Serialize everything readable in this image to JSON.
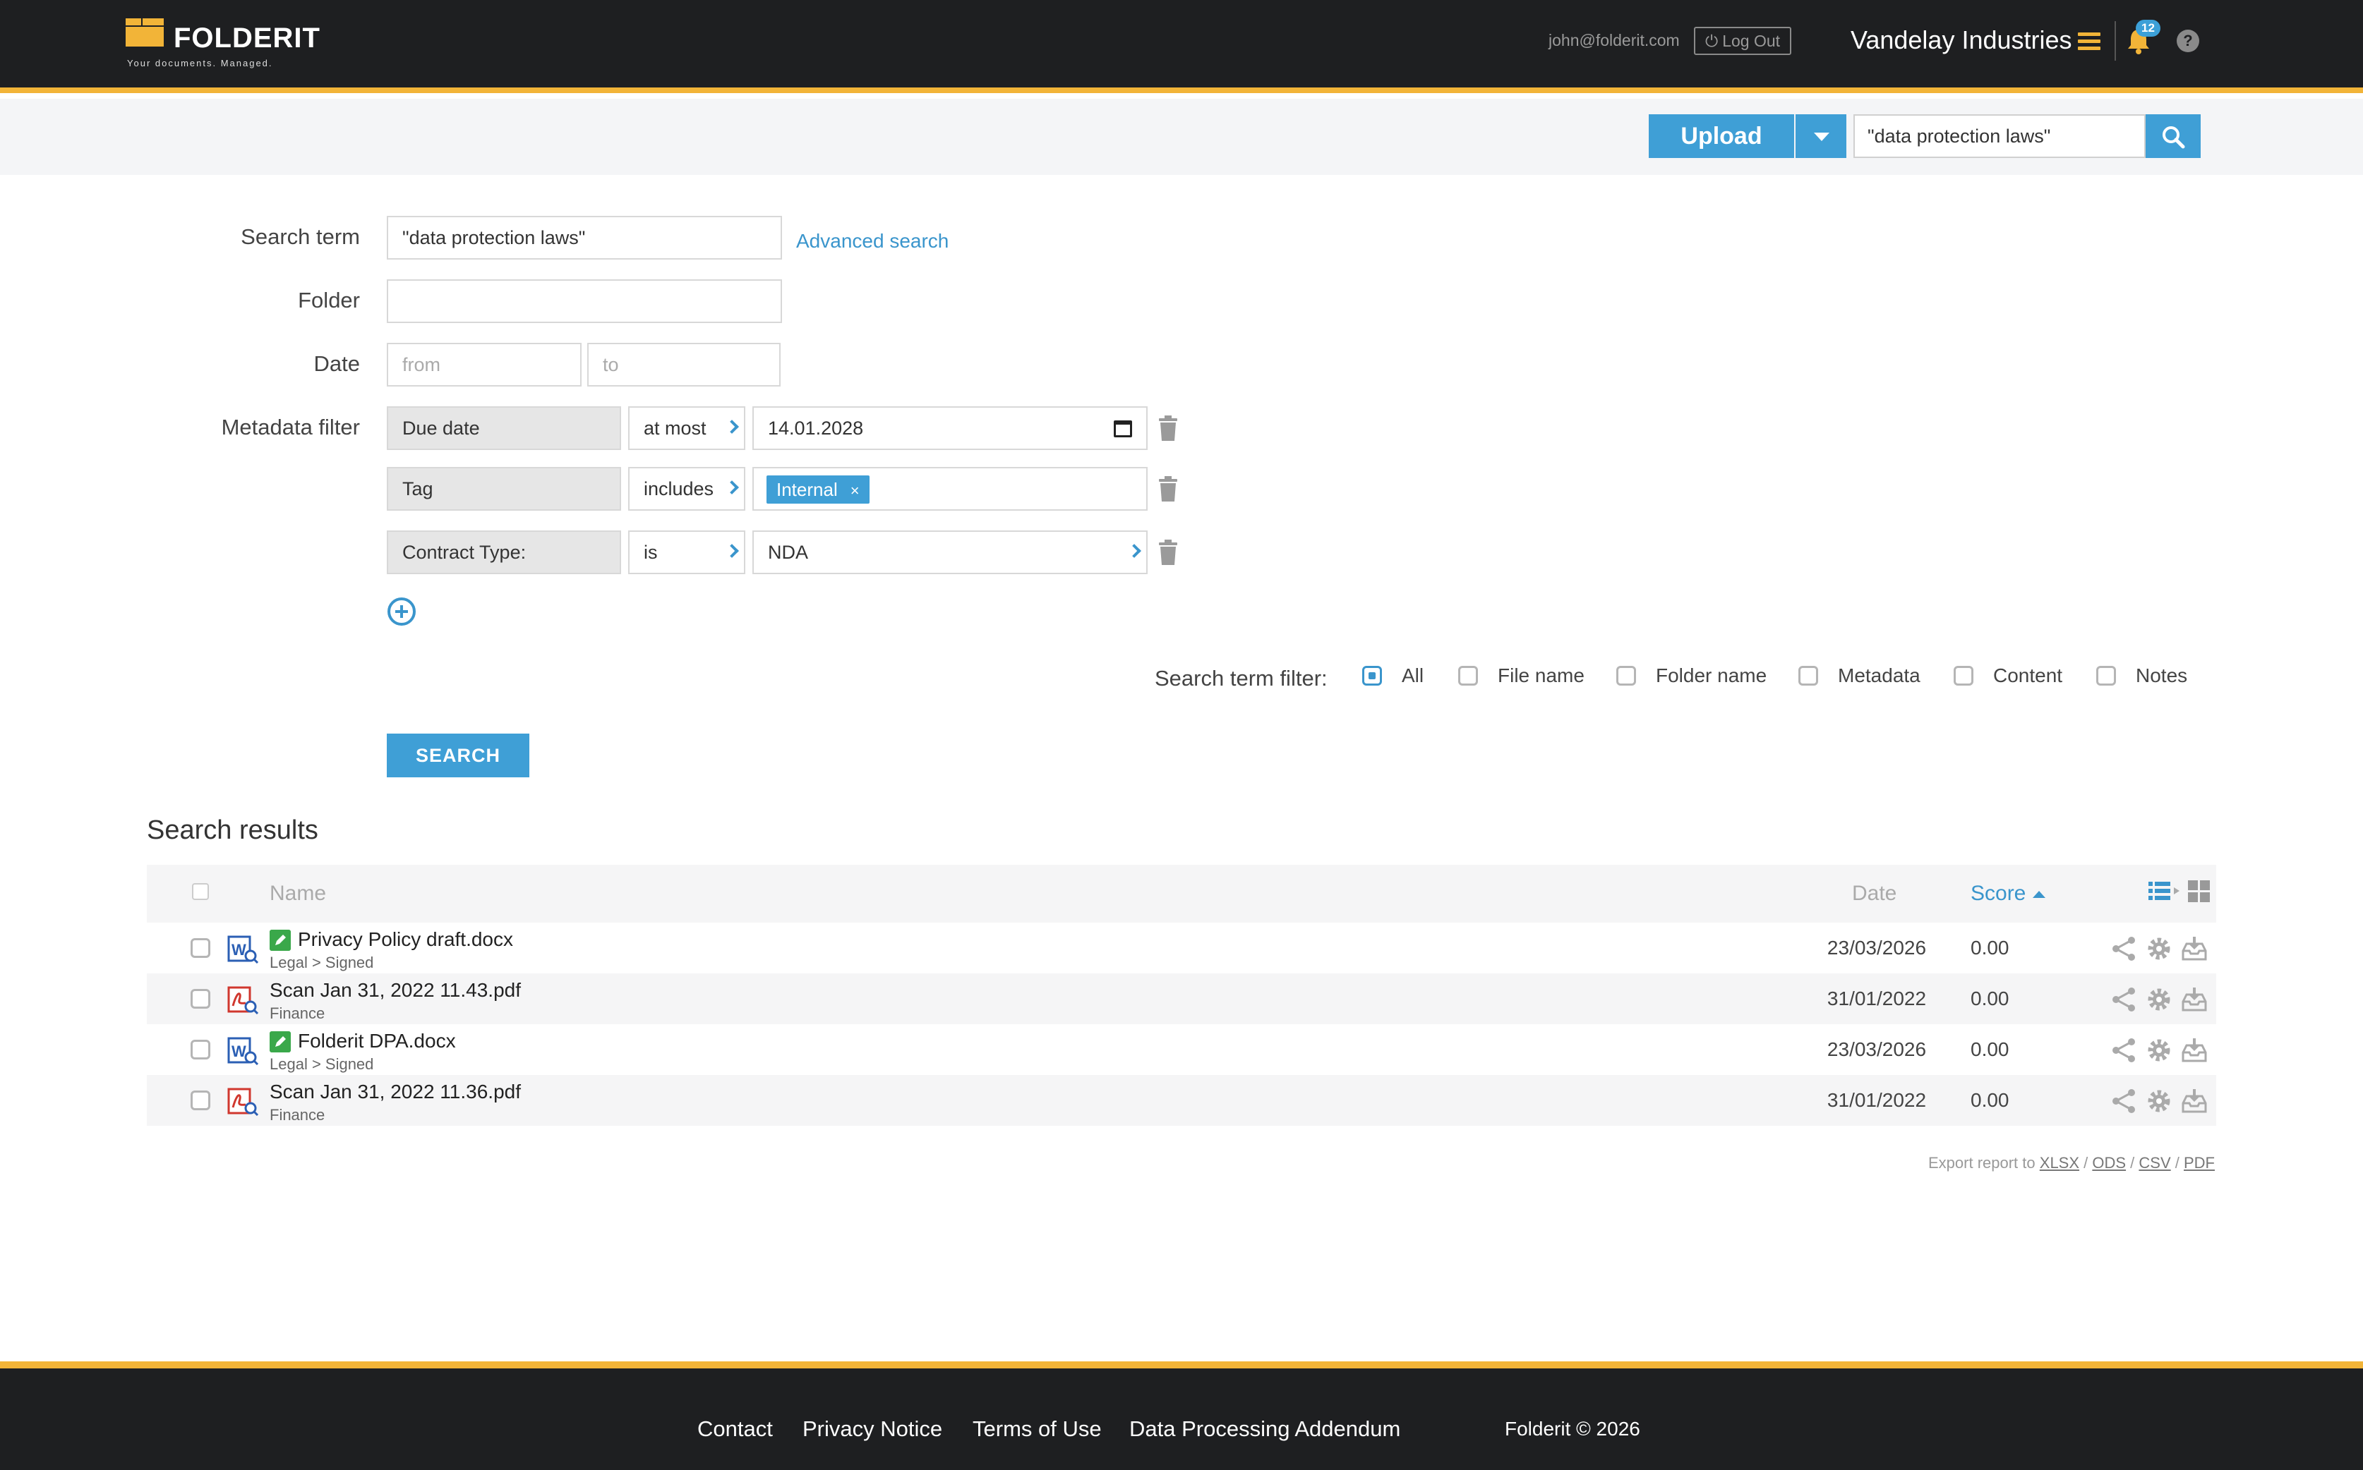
{
  "header": {
    "logo_text": "FOLDERIT",
    "logo_tagline": "Your documents. Managed.",
    "user_email": "john@folderit.com",
    "logout_label": "Log Out",
    "company": "Vandelay Industries",
    "notification_count": "12",
    "help_label": "?"
  },
  "toolbar": {
    "upload_label": "Upload",
    "search_value": "\"data protection laws\""
  },
  "form": {
    "search_term_label": "Search term",
    "search_term_value": "\"data protection laws\"",
    "advanced_search_label": "Advanced search",
    "folder_label": "Folder",
    "folder_value": "",
    "date_label": "Date",
    "date_from_placeholder": "from",
    "date_to_placeholder": "to",
    "metadata_label": "Metadata filter",
    "filters": [
      {
        "field": "Due date",
        "operator": "at most",
        "value": "14.01.2028"
      },
      {
        "field": "Tag",
        "operator": "includes",
        "value": "Internal"
      },
      {
        "field": "Contract Type:",
        "operator": "is",
        "value": "NDA"
      }
    ],
    "term_filter_label": "Search term filter:",
    "term_filter_options": [
      {
        "label": "All",
        "checked": true
      },
      {
        "label": "File name",
        "checked": false
      },
      {
        "label": "Folder name",
        "checked": false
      },
      {
        "label": "Metadata",
        "checked": false
      },
      {
        "label": "Content",
        "checked": false
      },
      {
        "label": "Notes",
        "checked": false
      }
    ],
    "search_button": "SEARCH"
  },
  "results": {
    "title": "Search results",
    "columns": {
      "name": "Name",
      "date": "Date",
      "score": "Score"
    },
    "rows": [
      {
        "name": "Privacy Policy draft.docx",
        "path": "Legal > Signed",
        "date": "23/03/2026",
        "score": "0.00",
        "type": "word-doc-icon",
        "edited": true
      },
      {
        "name": "Scan Jan 31, 2022 11.43.pdf",
        "path": "Finance",
        "date": "31/01/2022",
        "score": "0.00",
        "type": "pdf-icon",
        "edited": false
      },
      {
        "name": "Folderit DPA.docx",
        "path": "Legal > Signed",
        "date": "23/03/2026",
        "score": "0.00",
        "type": "word-doc-icon",
        "edited": true
      },
      {
        "name": "Scan Jan 31, 2022 11.36.pdf",
        "path": "Finance",
        "date": "31/01/2022",
        "score": "0.00",
        "type": "pdf-icon",
        "edited": false
      }
    ],
    "export_prefix": "Export report to",
    "export_formats": [
      "XLSX",
      "ODS",
      "CSV",
      "PDF"
    ]
  },
  "footer": {
    "links": [
      "Contact",
      "Privacy Notice",
      "Terms of Use",
      "Data Processing Addendum"
    ],
    "copyright": "Folderit © 2026"
  },
  "colors": {
    "accent_blue": "#3f9fd6",
    "brand_yellow": "#f2b438",
    "header_bg": "#1e1f21",
    "edit_green": "#3aa84a",
    "word_blue": "#2b5fb4",
    "pdf_red": "#d0372e"
  }
}
